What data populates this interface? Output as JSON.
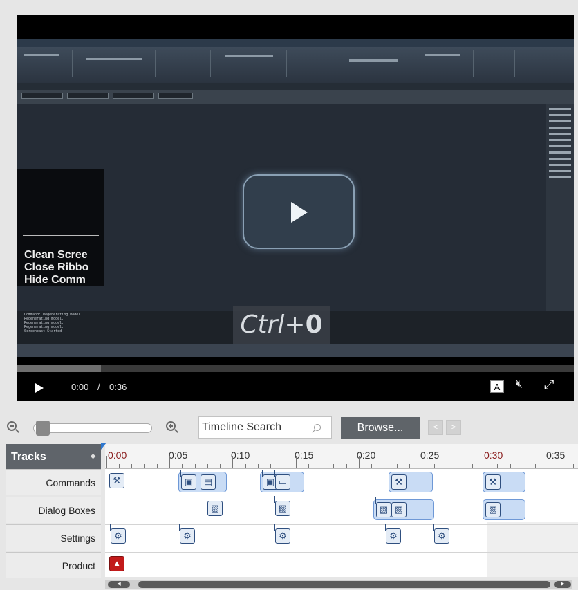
{
  "player": {
    "video_lines": [
      "Clean Scree",
      "Close Ribbo",
      "Hide Comm"
    ],
    "shortcut": "Ctrl+",
    "shortcut_key": "0",
    "time_current": "0:00",
    "time_separator": "/",
    "time_duration": "0:36",
    "caption_label": "A",
    "mute_icon": "speaker-mute-icon",
    "fullscreen_icon": "expand-icon",
    "progress_buffered": 0.15
  },
  "timeline_toolbar": {
    "search_placeholder": "Timeline Search",
    "browse_label": "Browse...",
    "prev_label": "<",
    "next_label": ">"
  },
  "tracks": {
    "header": "Tracks",
    "header_caret": "◆",
    "labels": [
      "Commands",
      "Dialog Boxes",
      "Settings",
      "Product"
    ],
    "ruler": [
      "0:00",
      "0:05",
      "0:10",
      "0:15",
      "0:20",
      "0:25",
      "0:30",
      "0:35"
    ],
    "ruler_highlight_color": "#8b1e1e",
    "clip_color": "#c9dcf5",
    "clip_border_color": "#6e98d6",
    "product_icon_color": "#c21a1a"
  },
  "cad_command_lines": [
    "Command: Regenerating model.",
    "Regenerating model.",
    "Regenerating model.",
    "Regenerating model.",
    "Screencast Started"
  ]
}
